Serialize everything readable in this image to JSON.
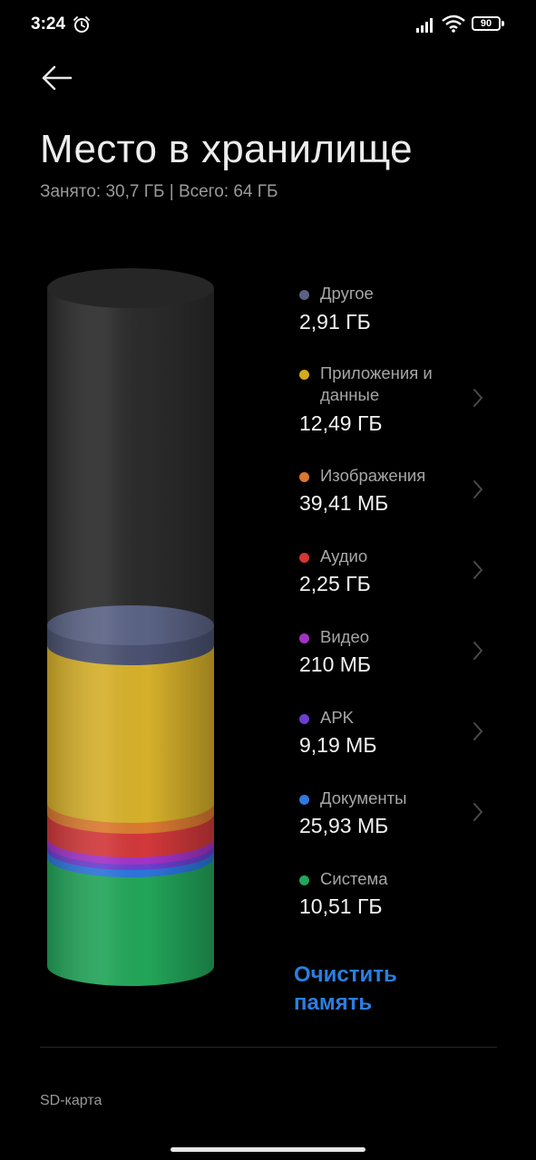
{
  "status_bar": {
    "time": "3:24",
    "battery_level": "90",
    "icons": [
      "alarm-icon",
      "signal-icon",
      "wifi-icon",
      "battery-icon"
    ]
  },
  "header": {
    "back_icon": "back-arrow-icon",
    "title": "Место в хранилище",
    "subtitle": "Занято: 30,7 ГБ | Всего: 64 ГБ"
  },
  "legend": [
    {
      "key": "other",
      "label": "Другое",
      "value": "2,91 ГБ",
      "color": "#5a6283",
      "has_chevron": false
    },
    {
      "key": "apps",
      "label": "Приложения и данные",
      "value": "12,49 ГБ",
      "color": "#d4aa1d",
      "has_chevron": true
    },
    {
      "key": "images",
      "label": "Изображения",
      "value": "39,41 МБ",
      "color": "#d9772e",
      "has_chevron": true
    },
    {
      "key": "audio",
      "label": "Аудио",
      "value": "2,25 ГБ",
      "color": "#d33634",
      "has_chevron": true
    },
    {
      "key": "video",
      "label": "Видео",
      "value": "210 МБ",
      "color": "#a232c4",
      "has_chevron": true
    },
    {
      "key": "apk",
      "label": "APK",
      "value": "9,19 МБ",
      "color": "#6c3ed0",
      "has_chevron": true
    },
    {
      "key": "documents",
      "label": "Документы",
      "value": "25,93 МБ",
      "color": "#2f78e0",
      "has_chevron": true
    },
    {
      "key": "system",
      "label": "Система",
      "value": "10,51 ГБ",
      "color": "#23a65a",
      "has_chevron": false
    }
  ],
  "actions": {
    "clean_label": "Очистить память",
    "sd_card_label": "SD-карта"
  },
  "colors": {
    "free_space": "#2b2b2b",
    "accent": "#2a7fe0"
  }
}
